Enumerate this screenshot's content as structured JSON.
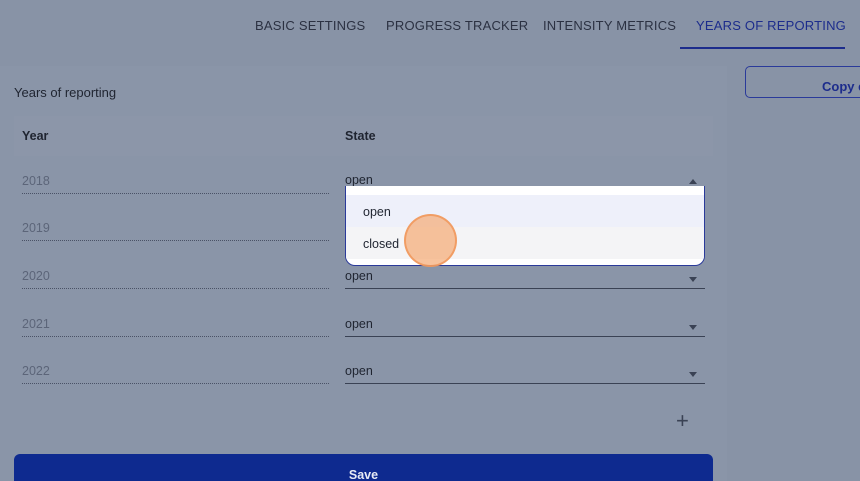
{
  "tabs": [
    {
      "label": "BASIC SETTINGS",
      "active": false
    },
    {
      "label": "PROGRESS TRACKER",
      "active": false
    },
    {
      "label": "INTENSITY METRICS",
      "active": false
    },
    {
      "label": "YEARS OF REPORTING",
      "active": true
    }
  ],
  "copy_button": {
    "label": "Copy e"
  },
  "section": {
    "title": "Years of reporting"
  },
  "table": {
    "headers": {
      "year": "Year",
      "state": "State"
    },
    "rows": [
      {
        "year": "2018",
        "state": "open"
      },
      {
        "year": "2019",
        "state": ""
      },
      {
        "year": "2020",
        "state": "open"
      },
      {
        "year": "2021",
        "state": "open"
      },
      {
        "year": "2022",
        "state": "open"
      }
    ]
  },
  "dropdown": {
    "options": [
      "open",
      "closed"
    ],
    "highlighted": "open"
  },
  "add_icon": "plus-icon",
  "save_button": {
    "label": "Save"
  },
  "colors": {
    "accent": "#1c2c8c",
    "save_bg": "#0e2a8f",
    "overlay": "#8893a6"
  }
}
